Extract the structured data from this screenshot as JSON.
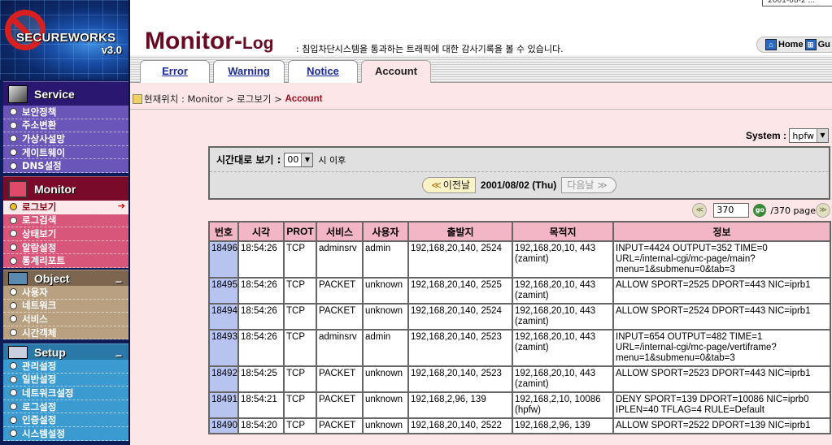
{
  "sidebar": {
    "logo": {
      "brand": "SECUREWORKS",
      "version": "v3.0"
    },
    "sections": [
      {
        "title": "Service",
        "items": [
          "보안정책",
          "주소변환",
          "가상사설망",
          "게이트웨이",
          "DNS설정"
        ]
      },
      {
        "title": "Monitor",
        "items": [
          "로그보기",
          "로그검색",
          "상태보기",
          "알람설정",
          "통계리포트"
        ],
        "active_index": 0
      },
      {
        "title": "Object",
        "collapse": "−",
        "items": [
          "사용자",
          "네트워크",
          "서비스",
          "시간객체"
        ]
      },
      {
        "title": "Setup",
        "collapse": "−",
        "items": [
          "관리설정",
          "일반설정",
          "네트워크설정",
          "로그설정",
          "인증설정",
          "시스템설정"
        ]
      }
    ],
    "active_arrow": "➔"
  },
  "header": {
    "date_partial": "2001-08-2 ...",
    "title_big": "Monitor-",
    "title_small": "Log",
    "subtitle": ": 침입차단시스템을 통과하는 트래픽에 대한 감사기록을 볼 수 있습니다.",
    "home_label": "Home",
    "guide_label": "Gu"
  },
  "tabs": [
    {
      "label": "Error"
    },
    {
      "label": "Warning"
    },
    {
      "label": "Notice"
    },
    {
      "label": "Account",
      "active": true
    }
  ],
  "breadcrumb": {
    "prefix": "현재위치 : Monitor > 로그보기 > ",
    "current": "Account"
  },
  "system": {
    "label": "System :",
    "value": "hpfw"
  },
  "filter": {
    "time_label": "시간대로 보기 :",
    "hour_value": "00",
    "after_label": "시 이후",
    "prev_label": "이전날",
    "date": "2001/08/02 (Thu)",
    "next_label": "다음날 ≫"
  },
  "pager": {
    "current_page": "370",
    "total": "/370 page",
    "go_label": "go"
  },
  "table": {
    "headers": [
      "번호",
      "시각",
      "PROT",
      "서비스",
      "사용자",
      "출발지",
      "목적지",
      "정보"
    ],
    "rows": [
      {
        "no": "18496",
        "time": "18:54:26",
        "prot": "TCP",
        "service": "adminsrv",
        "user": "admin",
        "src": "192,168,20,140, 2524",
        "dst": "192,168,20,10, 443",
        "dst_host": "(zamint)",
        "info": [
          "INPUT=4424 OUTPUT=352 TIME=0",
          "URL=/internal-cgi/mc-page/main?",
          "menu=1&submenu=0&tab=3"
        ]
      },
      {
        "no": "18495",
        "time": "18:54:26",
        "prot": "TCP",
        "service": "PACKET",
        "user": "unknown",
        "src": "192,168,20,140, 2525",
        "dst": "192,168,20,10, 443",
        "dst_host": "(zamint)",
        "info": [
          "ALLOW SPORT=2525 DPORT=443 NIC=iprb1"
        ]
      },
      {
        "no": "18494",
        "time": "18:54:26",
        "prot": "TCP",
        "service": "PACKET",
        "user": "unknown",
        "src": "192,168,20,140, 2524",
        "dst": "192,168,20,10, 443",
        "dst_host": "(zamint)",
        "info": [
          "ALLOW SPORT=2524 DPORT=443 NIC=iprb1"
        ]
      },
      {
        "no": "18493",
        "time": "18:54:26",
        "prot": "TCP",
        "service": "adminsrv",
        "user": "admin",
        "src": "192,168,20,140, 2523",
        "dst": "192,168,20,10, 443",
        "dst_host": "(zamint)",
        "info": [
          "INPUT=654 OUTPUT=482 TIME=1",
          "URL=/internal-cgi/mc-page/vertiframe?",
          "menu=1&submenu=0&tab=3"
        ]
      },
      {
        "no": "18492",
        "time": "18:54:25",
        "prot": "TCP",
        "service": "PACKET",
        "user": "unknown",
        "src": "192,168,20,140, 2523",
        "dst": "192,168,20,10, 443",
        "dst_host": "(zamint)",
        "info": [
          "ALLOW SPORT=2523 DPORT=443 NIC=iprb1"
        ]
      },
      {
        "no": "18491",
        "time": "18:54:21",
        "prot": "TCP",
        "service": "PACKET",
        "user": "unknown",
        "src": "192,168,2,96, 139",
        "dst": "192,168,2,10, 10086",
        "dst_host": "(hpfw)",
        "info": [
          "DENY SPORT=139 DPORT=10086 NIC=iprb0",
          "IPLEN=40 TFLAG=4 RULE=Default"
        ]
      },
      {
        "no": "18490",
        "time": "18:54:20",
        "prot": "TCP",
        "service": "PACKET",
        "user": "unknown",
        "src": "192,168,20,140, 2522",
        "dst": "192,168,2,96, 139",
        "dst_host": "",
        "info": [
          "ALLOW SPORT=2522 DPORT=139 NIC=iprb1"
        ]
      }
    ]
  }
}
